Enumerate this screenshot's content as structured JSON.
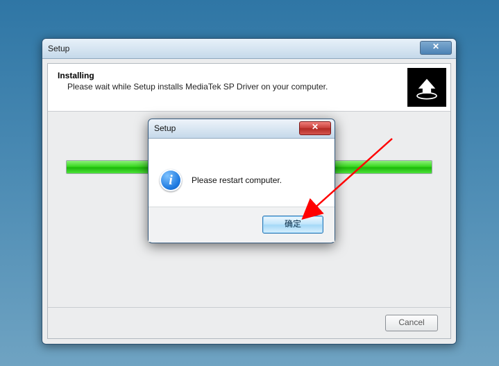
{
  "main": {
    "title": "Setup",
    "header_title": "Installing",
    "header_sub": "Please wait while Setup installs MediaTek SP Driver on your computer.",
    "cancel": "Cancel"
  },
  "dialog": {
    "title": "Setup",
    "message": "Please restart computer.",
    "ok": "确定"
  }
}
